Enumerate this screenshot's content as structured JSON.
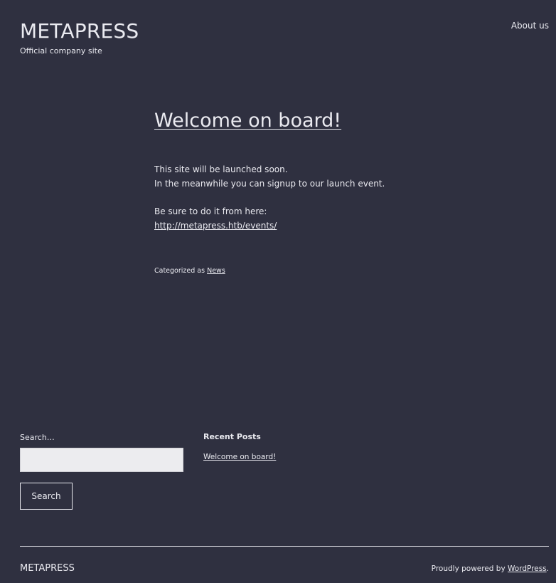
{
  "header": {
    "site_title": "METAPRESS",
    "tagline": "Official company site",
    "nav": {
      "about": "About us"
    }
  },
  "post": {
    "title": "Welcome on board!",
    "paragraph1_line1": "This site will be launched soon.",
    "paragraph1_line2": "In the meanwhile you can signup to our launch event.",
    "paragraph2_line1": "Be sure to do it from here:",
    "link": "http://metapress.htb/events/",
    "categorized_prefix": "Categorized as ",
    "category": "News"
  },
  "widgets": {
    "search": {
      "label": "Search…",
      "value": "",
      "button": "Search"
    },
    "recent_posts": {
      "heading": "Recent Posts",
      "items": [
        "Welcome on board!"
      ]
    }
  },
  "footer": {
    "site_title": "METAPRESS",
    "credit_prefix": "Proudly powered by ",
    "credit_link": "WordPress",
    "credit_suffix": "."
  },
  "colors": {
    "background": "#2f3040",
    "text": "#eaeaf0",
    "input_background": "#ececef"
  }
}
